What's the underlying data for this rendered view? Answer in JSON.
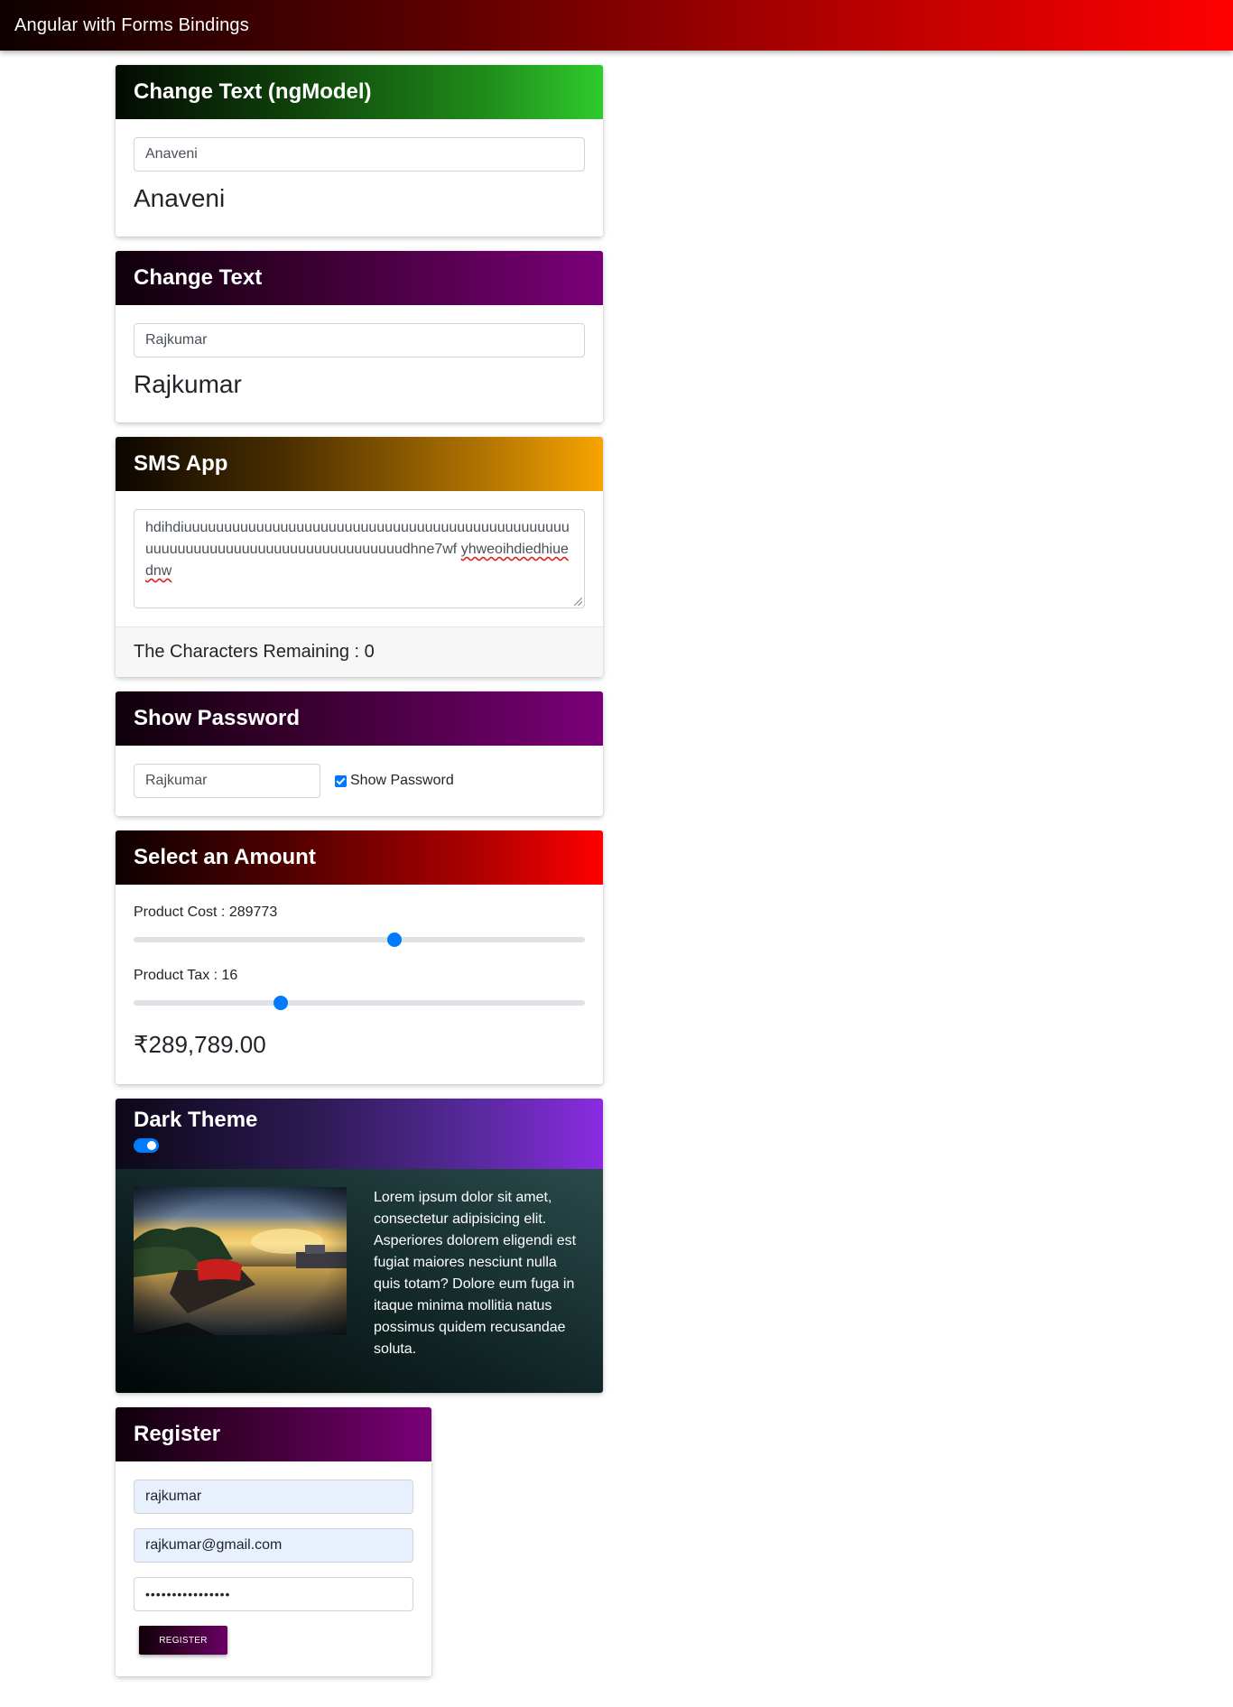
{
  "navbar": {
    "brand": "Angular with Forms Bindings"
  },
  "ngmodel_card": {
    "title": "Change Text (ngModel)",
    "input_value": "Anaveni",
    "display": "Anaveni"
  },
  "change_text_card": {
    "title": "Change Text",
    "input_value": "Rajkumar",
    "display": "Rajkumar"
  },
  "sms_card": {
    "title": "SMS App",
    "message_part1": "hdihdiuuuuuuuuuuuuuuuuuuuuuuuuuuuuuuuuuuuuuuuuuuuuuuuuuuuuuuuuuuuuuuuuuuuuuuuuuuuuuuuudhne7wf ",
    "message_part2": "yhweoihdiedhiuednw",
    "remaining_label": "The Characters Remaining : 0"
  },
  "password_card": {
    "title": "Show Password",
    "input_value": "Rajkumar",
    "checkbox_label": "Show Password",
    "checkbox_checked": true
  },
  "amount_card": {
    "title": "Select an Amount",
    "cost_label": "Product Cost : 289773",
    "cost_slider_fraction": 0.578,
    "tax_label": "Product Tax : 16",
    "tax_slider_fraction": 0.325,
    "total": "₹289,789.00"
  },
  "dark_card": {
    "title": "Dark Theme",
    "toggle_on": true,
    "image_icon": "sunset-boat-photo",
    "text": "Lorem ipsum dolor sit amet, consectetur adipisicing elit. Asperiores dolorem eligendi est fugiat maiores nesciunt nulla quis totam? Dolore eum fuga in itaque minima mollitia natus possimus quidem recusandae soluta."
  },
  "register_card": {
    "title": "Register",
    "username_value": "rajkumar",
    "email_value": "rajkumar@gmail.com",
    "password_value": "••••••••••••••••",
    "button_label": "REGISTER"
  },
  "colors": {
    "accent": "#007bff",
    "checkbox": "#0075ff"
  }
}
